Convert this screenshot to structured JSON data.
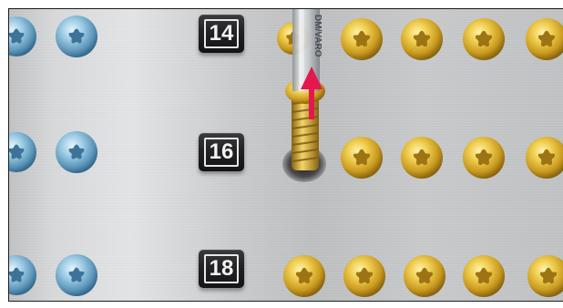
{
  "labels": {
    "size_14": "14",
    "size_16": "16",
    "size_18": "18"
  },
  "driver_text": "DM/VARO",
  "colors": {
    "blue_screw": "#7fb6d6",
    "gold_screw": "#d9b236",
    "arrow": "#e4174f",
    "label_bg": "#1e1e20"
  },
  "icons": {
    "arrow": "up-arrow-icon"
  }
}
